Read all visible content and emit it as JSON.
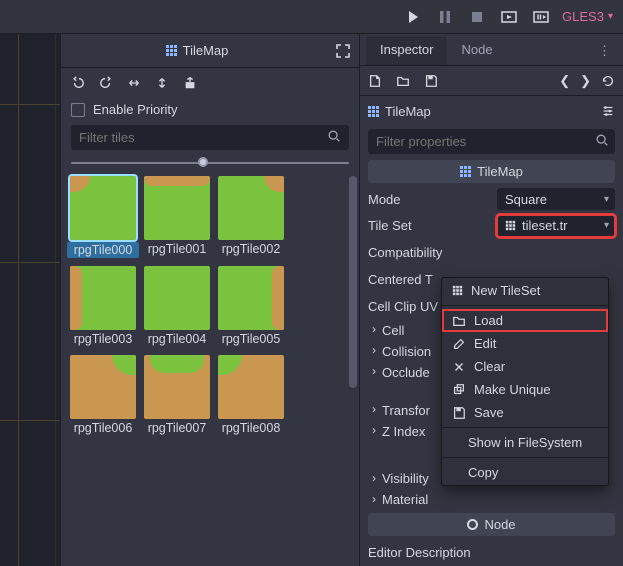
{
  "toolbar": {
    "renderer": "GLES3"
  },
  "tilePanel": {
    "title": "TileMap",
    "priorityLabel": "Enable Priority",
    "filterPlaceholder": "Filter tiles",
    "tiles": [
      {
        "label": "rpgTile000",
        "cls": "t0",
        "selected": true
      },
      {
        "label": "rpgTile001",
        "cls": "t1",
        "selected": false
      },
      {
        "label": "rpgTile002",
        "cls": "t2",
        "selected": false
      },
      {
        "label": "rpgTile003",
        "cls": "t3",
        "selected": false
      },
      {
        "label": "rpgTile004",
        "cls": "t4",
        "selected": false
      },
      {
        "label": "rpgTile005",
        "cls": "t5",
        "selected": false
      },
      {
        "label": "rpgTile006",
        "cls": "t6",
        "selected": false
      },
      {
        "label": "rpgTile007",
        "cls": "t7",
        "selected": false
      },
      {
        "label": "rpgTile008",
        "cls": "t8",
        "selected": false
      }
    ]
  },
  "inspector": {
    "tabs": {
      "inspector": "Inspector",
      "node": "Node"
    },
    "objectType": "TileMap",
    "filterPlaceholder": "Filter properties",
    "classHeader": "TileMap",
    "props": {
      "mode": {
        "label": "Mode",
        "value": "Square"
      },
      "tileSet": {
        "label": "Tile Set",
        "value": "tileset.tr"
      },
      "compat": "Compatibility",
      "centered": "Centered T",
      "cellClip": "Cell Clip UV"
    },
    "foldouts": {
      "cell": "Cell",
      "collision": "Collision",
      "occluder": "Occlude",
      "transform": "Transfor",
      "zindex": "Z Index",
      "visibility": "Visibility",
      "material": "Material"
    },
    "nodeHeader": "Node",
    "editorDesc": "Editor Description"
  },
  "contextMenu": {
    "newTileset": "New TileSet",
    "load": "Load",
    "edit": "Edit",
    "clear": "Clear",
    "makeUnique": "Make Unique",
    "save": "Save",
    "showInFs": "Show in FileSystem",
    "copy": "Copy"
  }
}
